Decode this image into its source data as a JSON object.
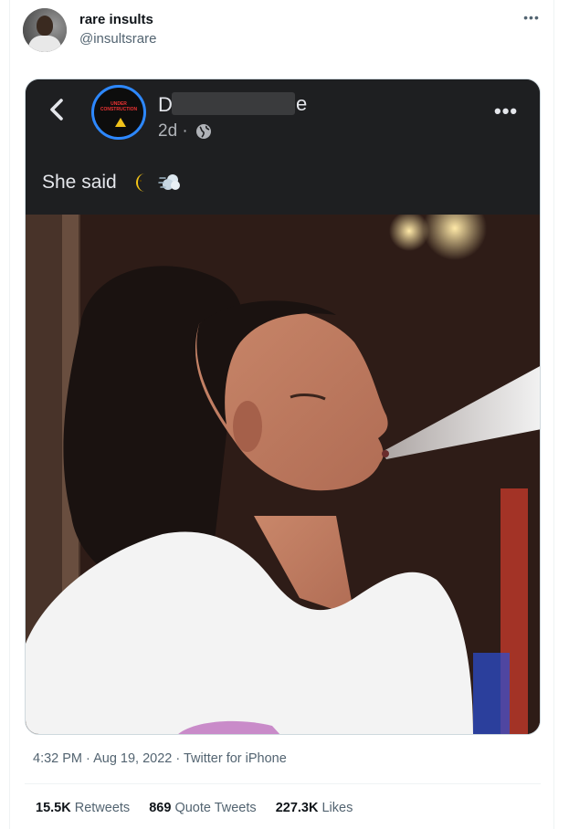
{
  "tweet": {
    "author": {
      "display_name": "rare insults",
      "handle": "@insultsrare",
      "avatar_icon": "user-avatar"
    },
    "more_icon": "more-horizontal-icon",
    "timestamp": "4:32 PM · Aug 19, 2022 · ",
    "source": "Twitter for iPhone",
    "stats": {
      "retweets_count": "15.5K",
      "retweets_label": "Retweets",
      "quotes_count": "869",
      "quotes_label": "Quote Tweets",
      "likes_count": "227.3K",
      "likes_label": "Likes"
    }
  },
  "embedded_post": {
    "page_logo_text": "UNDER CONSTRUCTION",
    "name_initial": "D",
    "name_tail": "e",
    "time": "2d ·",
    "caption": "She said",
    "caption_emojis": [
      "crescent-moon-icon",
      "dashing-away-icon"
    ],
    "colors": {
      "background": "#1e1f21",
      "text": "#e4e6eb",
      "secondary_text": "#b0b3b8",
      "logo_ring": "#2d88ff"
    }
  },
  "colors": {
    "primary_text": "#0f1419",
    "secondary_text": "#536471",
    "border": "#eff3f4"
  }
}
